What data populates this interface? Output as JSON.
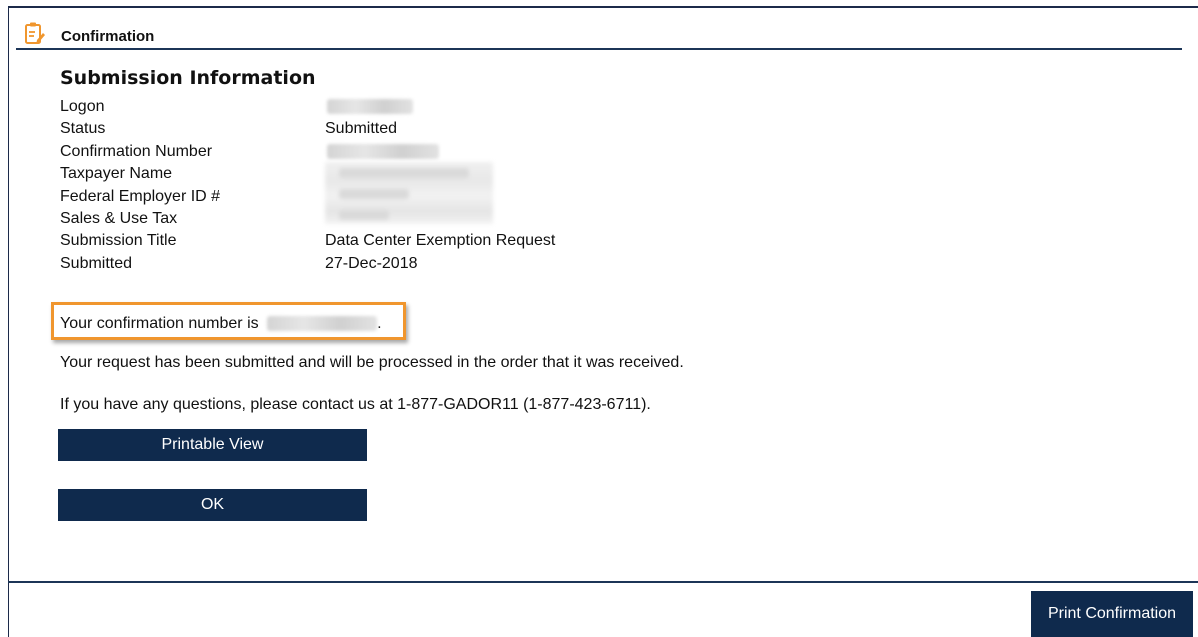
{
  "header": {
    "title": "Confirmation",
    "icon": "clipboard-edit-icon",
    "accent_color": "#f0962e"
  },
  "submission": {
    "section_title": "Submission Information",
    "fields": [
      {
        "label": "Logon",
        "value": ""
      },
      {
        "label": "Status",
        "value": "Submitted"
      },
      {
        "label": "Confirmation Number",
        "value": ""
      },
      {
        "label": "Taxpayer Name",
        "value": ""
      },
      {
        "label": "Federal Employer ID #",
        "value": ""
      },
      {
        "label": "Sales & Use Tax",
        "value": ""
      },
      {
        "label": "Submission Title",
        "value": "Data Center Exemption Request"
      },
      {
        "label": "Submitted",
        "value": "27-Dec-2018"
      }
    ]
  },
  "confirmation": {
    "prefix": "Your confirmation number is",
    "suffix": ".",
    "highlight_color": "#f0962e"
  },
  "messages": {
    "processed": "Your request has been submitted and will be processed in the order that it was received.",
    "contact": "If you have any questions, please contact us at 1-877-GADOR11 (1-877-423-6711)."
  },
  "buttons": {
    "printable_view": "Printable View",
    "ok": "OK",
    "print_confirmation": "Print Confirmation",
    "color": "#0f2a4d"
  }
}
